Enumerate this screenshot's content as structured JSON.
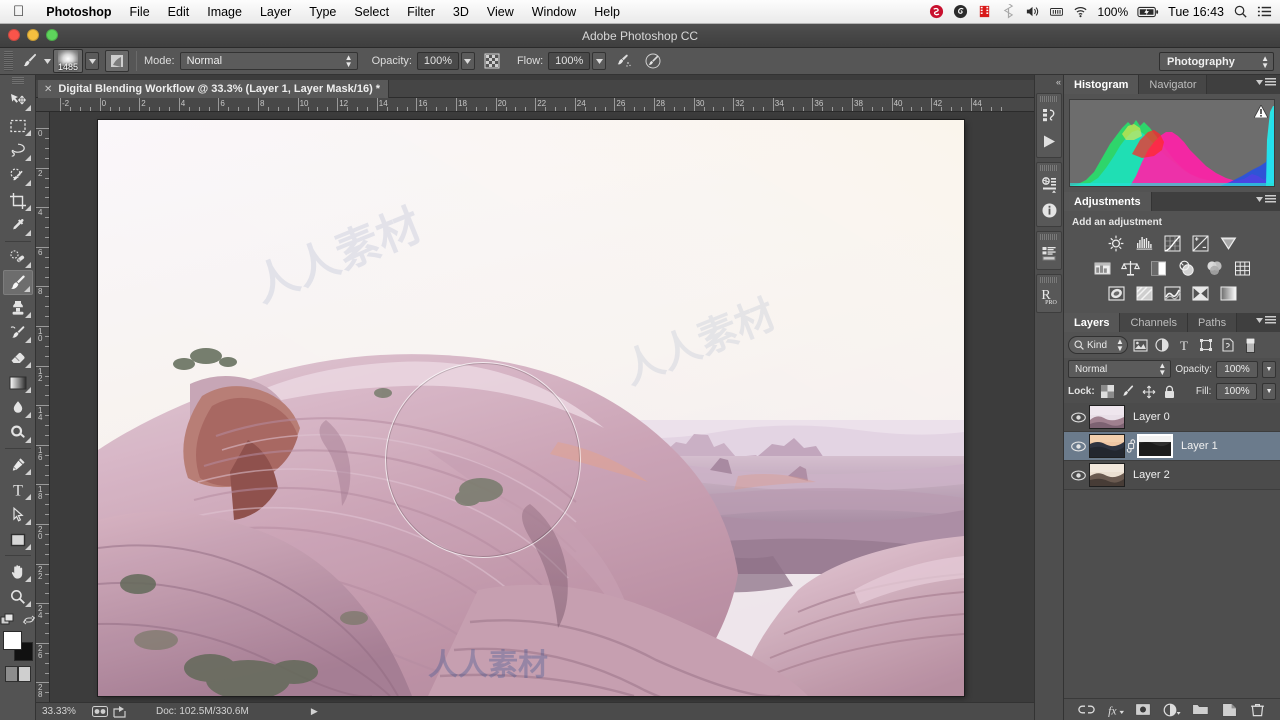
{
  "menubar": {
    "apple_icon": "apple-icon",
    "items": [
      {
        "label": "Photoshop",
        "bold": true
      },
      {
        "label": "File",
        "bold": false
      },
      {
        "label": "Edit",
        "bold": false
      },
      {
        "label": "Image",
        "bold": false
      },
      {
        "label": "Layer",
        "bold": false
      },
      {
        "label": "Type",
        "bold": false
      },
      {
        "label": "Select",
        "bold": false
      },
      {
        "label": "Filter",
        "bold": false
      },
      {
        "label": "3D",
        "bold": false
      },
      {
        "label": "View",
        "bold": false
      },
      {
        "label": "Window",
        "bold": false
      },
      {
        "label": "Help",
        "bold": false
      }
    ],
    "status": {
      "battery_percent": "100%",
      "clock": "Tue 16:43",
      "icons": [
        "sophos-icon",
        "spiral-icon",
        "film-strip-icon",
        "bluetooth-icon",
        "volume-icon",
        "battery-meter-icon",
        "wifi-icon",
        "battery-charging-icon",
        "spotlight-search-icon",
        "notification-center-icon"
      ]
    }
  },
  "titlebar": {
    "title": "Adobe Photoshop CC",
    "window_buttons": [
      "close-button",
      "minimize-button",
      "zoom-button"
    ]
  },
  "options_bar": {
    "tool_icon": "brush-tool-icon",
    "brush_size": "1485",
    "brush_preset_icon": "brush-preset-picker-icon",
    "brush_panel_icon": "brush-panel-toggle-icon",
    "mode_label": "Mode:",
    "mode_value": "Normal",
    "opacity_label": "Opacity:",
    "opacity_value": "100%",
    "opacity_pressure_icon": "tablet-pressure-opacity-icon",
    "flow_label": "Flow:",
    "flow_value": "100%",
    "airbrush_icon": "airbrush-icon",
    "smoothing_icon": "tablet-pressure-size-icon",
    "workspace_value": "Photography"
  },
  "document_tab": {
    "close_icon": "close-tab-icon",
    "title": "Digital Blending Workflow @ 33.3% (Layer 1, Layer Mask/16) *"
  },
  "toolbar": {
    "tools": [
      {
        "name": "move-tool",
        "active": false,
        "has_flyout": true
      },
      {
        "name": "rectangular-marquee-tool",
        "active": false,
        "has_flyout": true
      },
      {
        "name": "lasso-tool",
        "active": false,
        "has_flyout": true
      },
      {
        "name": "quick-selection-tool",
        "active": false,
        "has_flyout": true
      },
      {
        "name": "crop-tool",
        "active": false,
        "has_flyout": true
      },
      {
        "name": "eyedropper-tool",
        "active": false,
        "has_flyout": true
      },
      {
        "name": "spot-healing-brush-tool",
        "active": false,
        "has_flyout": true
      },
      {
        "name": "brush-tool",
        "active": true,
        "has_flyout": true
      },
      {
        "name": "clone-stamp-tool",
        "active": false,
        "has_flyout": true
      },
      {
        "name": "history-brush-tool",
        "active": false,
        "has_flyout": true
      },
      {
        "name": "eraser-tool",
        "active": false,
        "has_flyout": true
      },
      {
        "name": "gradient-tool",
        "active": false,
        "has_flyout": true
      },
      {
        "name": "blur-tool",
        "active": false,
        "has_flyout": true
      },
      {
        "name": "dodge-tool",
        "active": false,
        "has_flyout": true
      },
      {
        "name": "pen-tool",
        "active": false,
        "has_flyout": true
      },
      {
        "name": "horizontal-type-tool",
        "active": false,
        "has_flyout": true
      },
      {
        "name": "path-selection-tool",
        "active": false,
        "has_flyout": true
      },
      {
        "name": "rectangle-shape-tool",
        "active": false,
        "has_flyout": true
      },
      {
        "name": "hand-tool",
        "active": false,
        "has_flyout": true
      },
      {
        "name": "zoom-tool",
        "active": false,
        "has_flyout": true
      }
    ],
    "edit_toolbar_icon": "edit-toolbar-icon",
    "swap_colors_icon": "swap-colors-icon",
    "foreground_color": "#ffffff",
    "background_color": "#111111",
    "quick_mask_icon": "quick-mask-mode-icon"
  },
  "rulers": {
    "horizontal_ticks": [
      "-2",
      "0",
      "2",
      "4",
      "6",
      "8",
      "10",
      "12",
      "14",
      "16",
      "18",
      "20",
      "22",
      "24",
      "26",
      "28",
      "30",
      "32",
      "34",
      "36",
      "38",
      "40",
      "42",
      "44"
    ],
    "vertical_ticks": [
      "0",
      "2",
      "4",
      "6",
      "8",
      "10",
      "12",
      "14",
      "16",
      "18",
      "20",
      "22",
      "24",
      "26",
      "28"
    ],
    "unit": "inches"
  },
  "canvas": {
    "image_description": "Desert canyon landscape with layered sandstone arch at sunrise, pink-violet cast",
    "brush_cursor": "brush-cursor-circle",
    "watermark_text": "人人素材"
  },
  "status_bar": {
    "zoom_level": "33.33%",
    "preview_icon": "preview-toggle-icon",
    "share_icon": "share-icon",
    "doc_info": "Doc: 102.5M/330.6M",
    "expand_icon": "expand-status-icon"
  },
  "icon_rail": {
    "collapse_icon": "collapse-panels-icon",
    "groups": [
      {
        "icons": [
          "history-panel-icon",
          "actions-play-icon"
        ]
      },
      {
        "icons": [
          "properties-panel-icon",
          "info-panel-icon"
        ]
      },
      {
        "icons": [
          "layer-comps-icon"
        ]
      },
      {
        "icons": [
          "raw-pro-icon"
        ]
      }
    ]
  },
  "histogram_panel": {
    "tabs": [
      {
        "label": "Histogram",
        "active": true
      },
      {
        "label": "Navigator",
        "active": false
      }
    ],
    "menu_icon": "panel-menu-icon",
    "warning_icon": "cached-data-warning-icon",
    "channel": "RGB composite"
  },
  "adjustments_panel": {
    "tab_label": "Adjustments",
    "menu_icon": "panel-menu-icon",
    "heading": "Add an adjustment",
    "buttons": [
      {
        "name": "brightness-contrast-adjustment-icon"
      },
      {
        "name": "levels-adjustment-icon"
      },
      {
        "name": "curves-adjustment-icon"
      },
      {
        "name": "exposure-adjustment-icon"
      },
      {
        "name": "vibrance-adjustment-icon"
      },
      {
        "name": "hue-saturation-adjustment-icon"
      },
      {
        "name": "color-balance-adjustment-icon"
      },
      {
        "name": "black-white-adjustment-icon"
      },
      {
        "name": "photo-filter-adjustment-icon"
      },
      {
        "name": "channel-mixer-adjustment-icon"
      },
      {
        "name": "color-lookup-adjustment-icon"
      },
      {
        "name": "invert-adjustment-icon"
      },
      {
        "name": "posterize-adjustment-icon"
      },
      {
        "name": "threshold-adjustment-icon"
      },
      {
        "name": "selective-color-adjustment-icon"
      },
      {
        "name": "gradient-map-adjustment-icon"
      }
    ]
  },
  "layers_panel": {
    "tabs": [
      {
        "label": "Layers",
        "active": true
      },
      {
        "label": "Channels",
        "active": false
      },
      {
        "label": "Paths",
        "active": false
      }
    ],
    "menu_icon": "panel-menu-icon",
    "filter": {
      "kind_label": "Kind",
      "search_icon": "search-icon",
      "icons": [
        "filter-pixel-icon",
        "filter-adjustment-icon",
        "filter-type-icon",
        "filter-shape-icon",
        "filter-smart-object-icon",
        "filter-toggle-icon"
      ]
    },
    "blend_mode": "Normal",
    "opacity_label": "Opacity:",
    "opacity_value": "100%",
    "lock_label": "Lock:",
    "lock_icons": [
      "lock-transparent-pixels-icon",
      "lock-image-pixels-icon",
      "lock-position-icon",
      "lock-all-icon"
    ],
    "fill_label": "Fill:",
    "fill_value": "100%",
    "layers": [
      {
        "name": "Layer 0",
        "visible": true,
        "selected": false,
        "has_mask": false,
        "thumb_top": "#d9c3d0",
        "thumb_bottom": "#7a6070"
      },
      {
        "name": "Layer 1",
        "visible": true,
        "selected": true,
        "has_mask": true,
        "thumb_top": "#e8b79a",
        "thumb_bottom": "#2e3440"
      },
      {
        "name": "Layer 2",
        "visible": true,
        "selected": false,
        "has_mask": false,
        "thumb_top": "#e2cbb8",
        "thumb_bottom": "#3a3230"
      }
    ],
    "bottom_buttons": [
      {
        "name": "link-layers-button"
      },
      {
        "name": "layer-style-fx-button"
      },
      {
        "name": "add-layer-mask-button"
      },
      {
        "name": "new-adjustment-layer-button"
      },
      {
        "name": "new-group-button"
      },
      {
        "name": "new-layer-button"
      },
      {
        "name": "delete-layer-button"
      }
    ]
  },
  "colors": {
    "accent_selected_layer": "#6b7b8c",
    "panel_bg": "#535353",
    "chrome_bg": "#4e4e4e",
    "canvas_bg": "#3c3c3c"
  }
}
